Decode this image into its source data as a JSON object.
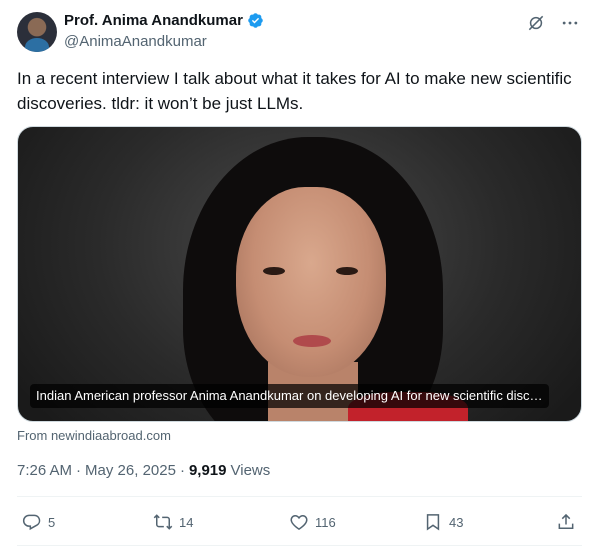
{
  "author": {
    "display_name": "Prof. Anima Anandkumar",
    "handle": "@AnimaAnandkumar",
    "verified": true
  },
  "tweet": {
    "text": "In a recent interview I talk about what it takes for AI to make new scientific discoveries. tldr: it won’t be just LLMs.",
    "media_caption": "Indian American professor Anima Anandkumar on developing AI for new scientific disc…",
    "source": "From newindiaabroad.com",
    "time": "7:26 AM",
    "date": "May 26, 2025",
    "views_count": "9,919",
    "views_label": "Views",
    "separator": "·"
  },
  "actions": {
    "replies": "5",
    "reposts": "14",
    "likes": "116",
    "bookmarks": "43"
  },
  "colors": {
    "accent": "#1d9bf0",
    "secondary_text": "#536471",
    "primary_text": "#0f1419"
  },
  "icons": {
    "verified": "verified-badge-icon",
    "grok": "grok-icon",
    "more": "more-icon",
    "reply": "reply-icon",
    "repost": "repost-icon",
    "like": "heart-icon",
    "bookmark": "bookmark-icon",
    "share": "share-icon"
  }
}
